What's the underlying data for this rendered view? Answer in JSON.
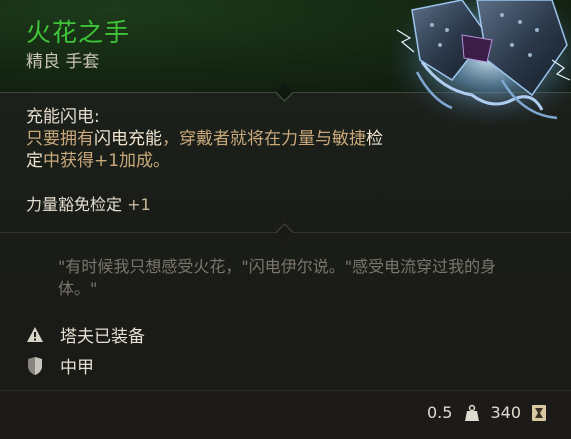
{
  "item": {
    "name": "火花之手",
    "subtitle": "精良 手套"
  },
  "ability": {
    "title": "充能闪电:",
    "desc_prefix": "只要拥有",
    "desc_highlight1": "闪电充能",
    "desc_mid": "，穿戴者就将在力量与敏捷",
    "desc_highlight2": "检定",
    "desc_suffix": "中获得+1加成。"
  },
  "bonus": {
    "label": "力量豁免检定",
    "value": "+1"
  },
  "flavor_text": "\"有时候我只想感受火花，\"闪电伊尔说。\"感受电流穿过我的身体。\"",
  "properties": [
    {
      "icon": "warning-icon",
      "label": "塔夫已装备"
    },
    {
      "icon": "shield-icon",
      "label": "中甲"
    }
  ],
  "footer": {
    "weight": "0.5",
    "weight_icon": "weight-icon",
    "value": "340",
    "value_icon": "gold-coin-icon"
  },
  "colors": {
    "item_name": "#3fc43a",
    "highlight_text": "#c9a97c",
    "flavor_text": "#7b766c"
  }
}
